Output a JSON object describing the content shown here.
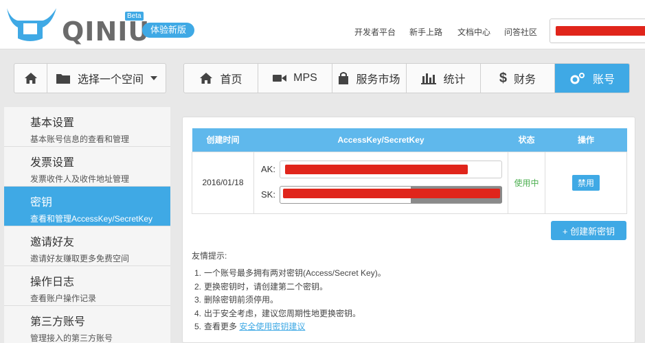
{
  "header": {
    "logo_text": "QINIU",
    "beta_badge": "Beta",
    "new_version_pill": "体验新版",
    "top_nav": [
      {
        "label": "开发者平台"
      },
      {
        "label": "新手上路"
      },
      {
        "label": "文档中心"
      },
      {
        "label": "问答社区"
      }
    ]
  },
  "nav": {
    "space_selector": "选择一个空间",
    "tabs": [
      {
        "label": "首页",
        "icon": "home-icon"
      },
      {
        "label": "MPS",
        "icon": "video-camera-icon"
      },
      {
        "label": "服务市场",
        "icon": "bag-icon"
      },
      {
        "label": "统计",
        "icon": "bar-chart-icon"
      },
      {
        "label": "财务",
        "icon": "dollar-icon"
      },
      {
        "label": "账号",
        "icon": "gears-icon"
      }
    ],
    "active_tab": "账号"
  },
  "sidebar": {
    "items": [
      {
        "title": "基本设置",
        "desc": "基本账号信息的查看和管理"
      },
      {
        "title": "发票设置",
        "desc": "发票收件人及收件地址管理"
      },
      {
        "title": "密钥",
        "desc": "查看和管理AccessKey/SecretKey"
      },
      {
        "title": "邀请好友",
        "desc": "邀请好友赚取更多免费空间"
      },
      {
        "title": "操作日志",
        "desc": "查看账户操作记录"
      },
      {
        "title": "第三方账号",
        "desc": "管理接入的第三方账号"
      }
    ],
    "active_item": "密钥"
  },
  "keys_table": {
    "headers": [
      "创建时间",
      "AccessKey/SecretKey",
      "状态",
      "操作"
    ],
    "rows": [
      {
        "created": "2016/01/18",
        "ak_label": "AK:",
        "sk_label": "SK:",
        "status": "使用中",
        "action": "禁用"
      }
    ]
  },
  "create_button": "+ 创建新密钥",
  "tips": {
    "title": "友情提示:",
    "items": [
      {
        "num": "1.",
        "text": "一个账号最多拥有两对密钥(Access/Secret Key)。"
      },
      {
        "num": "2.",
        "text": "更换密钥时，请创建第二个密钥。"
      },
      {
        "num": "3.",
        "text": "删除密钥前须停用。"
      },
      {
        "num": "4.",
        "text": "出于安全考虑，建议您周期性地更换密钥。"
      },
      {
        "num": "5.",
        "text": "查看更多 ",
        "link": "安全使用密钥建议"
      }
    ]
  },
  "colors": {
    "accent": "#3fa9e5",
    "redaction": "#e0251b",
    "status_ok": "#4caf50"
  }
}
